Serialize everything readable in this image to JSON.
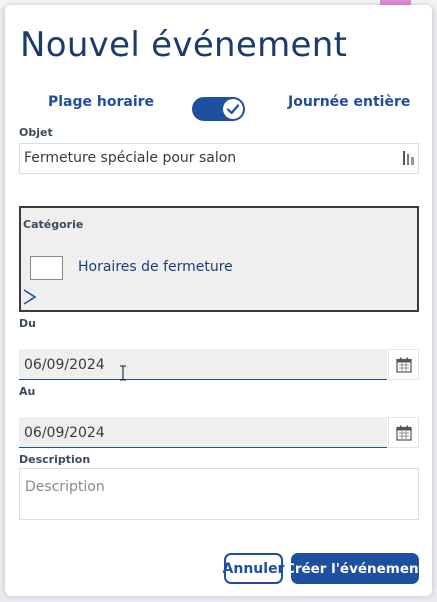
{
  "dialog": {
    "title": "Nouvel événement"
  },
  "mode": {
    "left_label": "Plage horaire",
    "right_label": "Journée entière",
    "toggle_on": true
  },
  "objet": {
    "label": "Objet",
    "value": "Fermeture spéciale pour salon"
  },
  "categorie": {
    "label": "Catégorie",
    "option_label": "Horaires de fermeture"
  },
  "du": {
    "label": "Du",
    "value": "06/09/2024"
  },
  "au": {
    "label": "Au",
    "value": "06/09/2024"
  },
  "description": {
    "label": "Description",
    "placeholder": "Description"
  },
  "actions": {
    "cancel_label": "Annuler",
    "create_label": "Créer l'événement"
  },
  "colors": {
    "accent": "#1f4fa1",
    "title": "#1b3c6b"
  }
}
